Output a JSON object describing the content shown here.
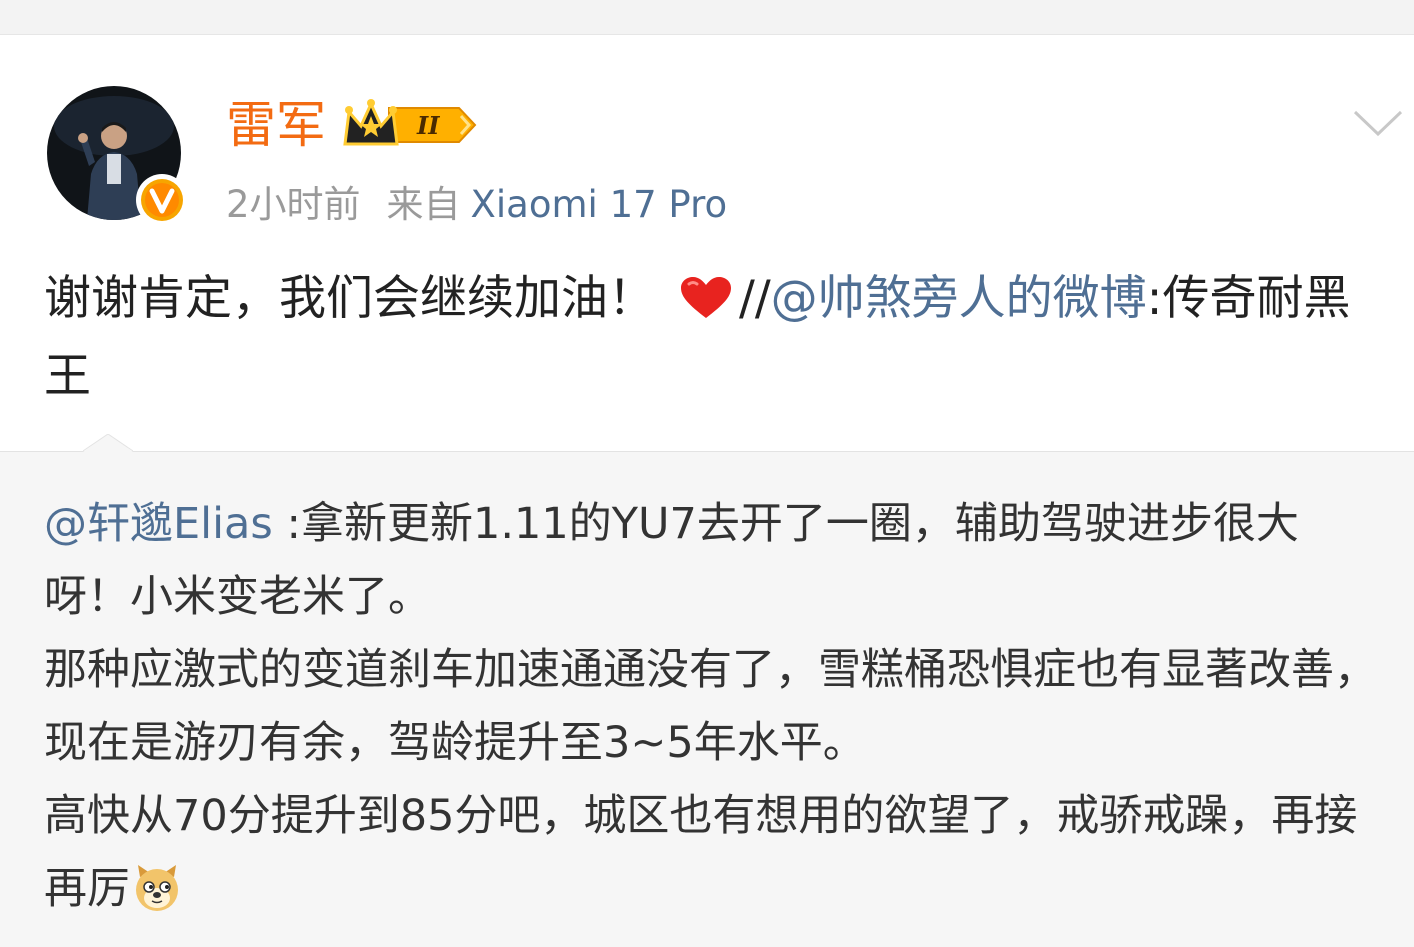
{
  "post": {
    "username": "雷军",
    "time": "2小时前",
    "from_label": "来自",
    "device": "Xiaomi 17 Pro",
    "text_main": "谢谢肯定，我们会继续加油！",
    "heart_icon": "red-heart-emoji",
    "repost_prefix": "//",
    "repost_mention": "@帅煞旁人的微博",
    "repost_colon": ":",
    "repost_tail": "传奇耐黑王",
    "vip_level": "II"
  },
  "repost": {
    "mention": "@轩邈Elias",
    "line1": " :拿新更新1.11的YU7去开了一圈，辅助驾驶进步很大呀！小米变老米了。",
    "line2": "那种应激式的变道刹车加速通通没有了，雪糕桶恐惧症也有显著改善，现在是游刃有余，驾龄提升至3~5年水平。",
    "line3": "高快从70分提升到85分吧，城区也有想用的欲望了，戒骄戒躁，再接再厉",
    "emoji_icon": "doge-emoji"
  },
  "colors": {
    "username": "#f36b12",
    "link": "#4f6f94",
    "meta": "#9a9a9a",
    "repost_bg": "#f6f6f6"
  }
}
